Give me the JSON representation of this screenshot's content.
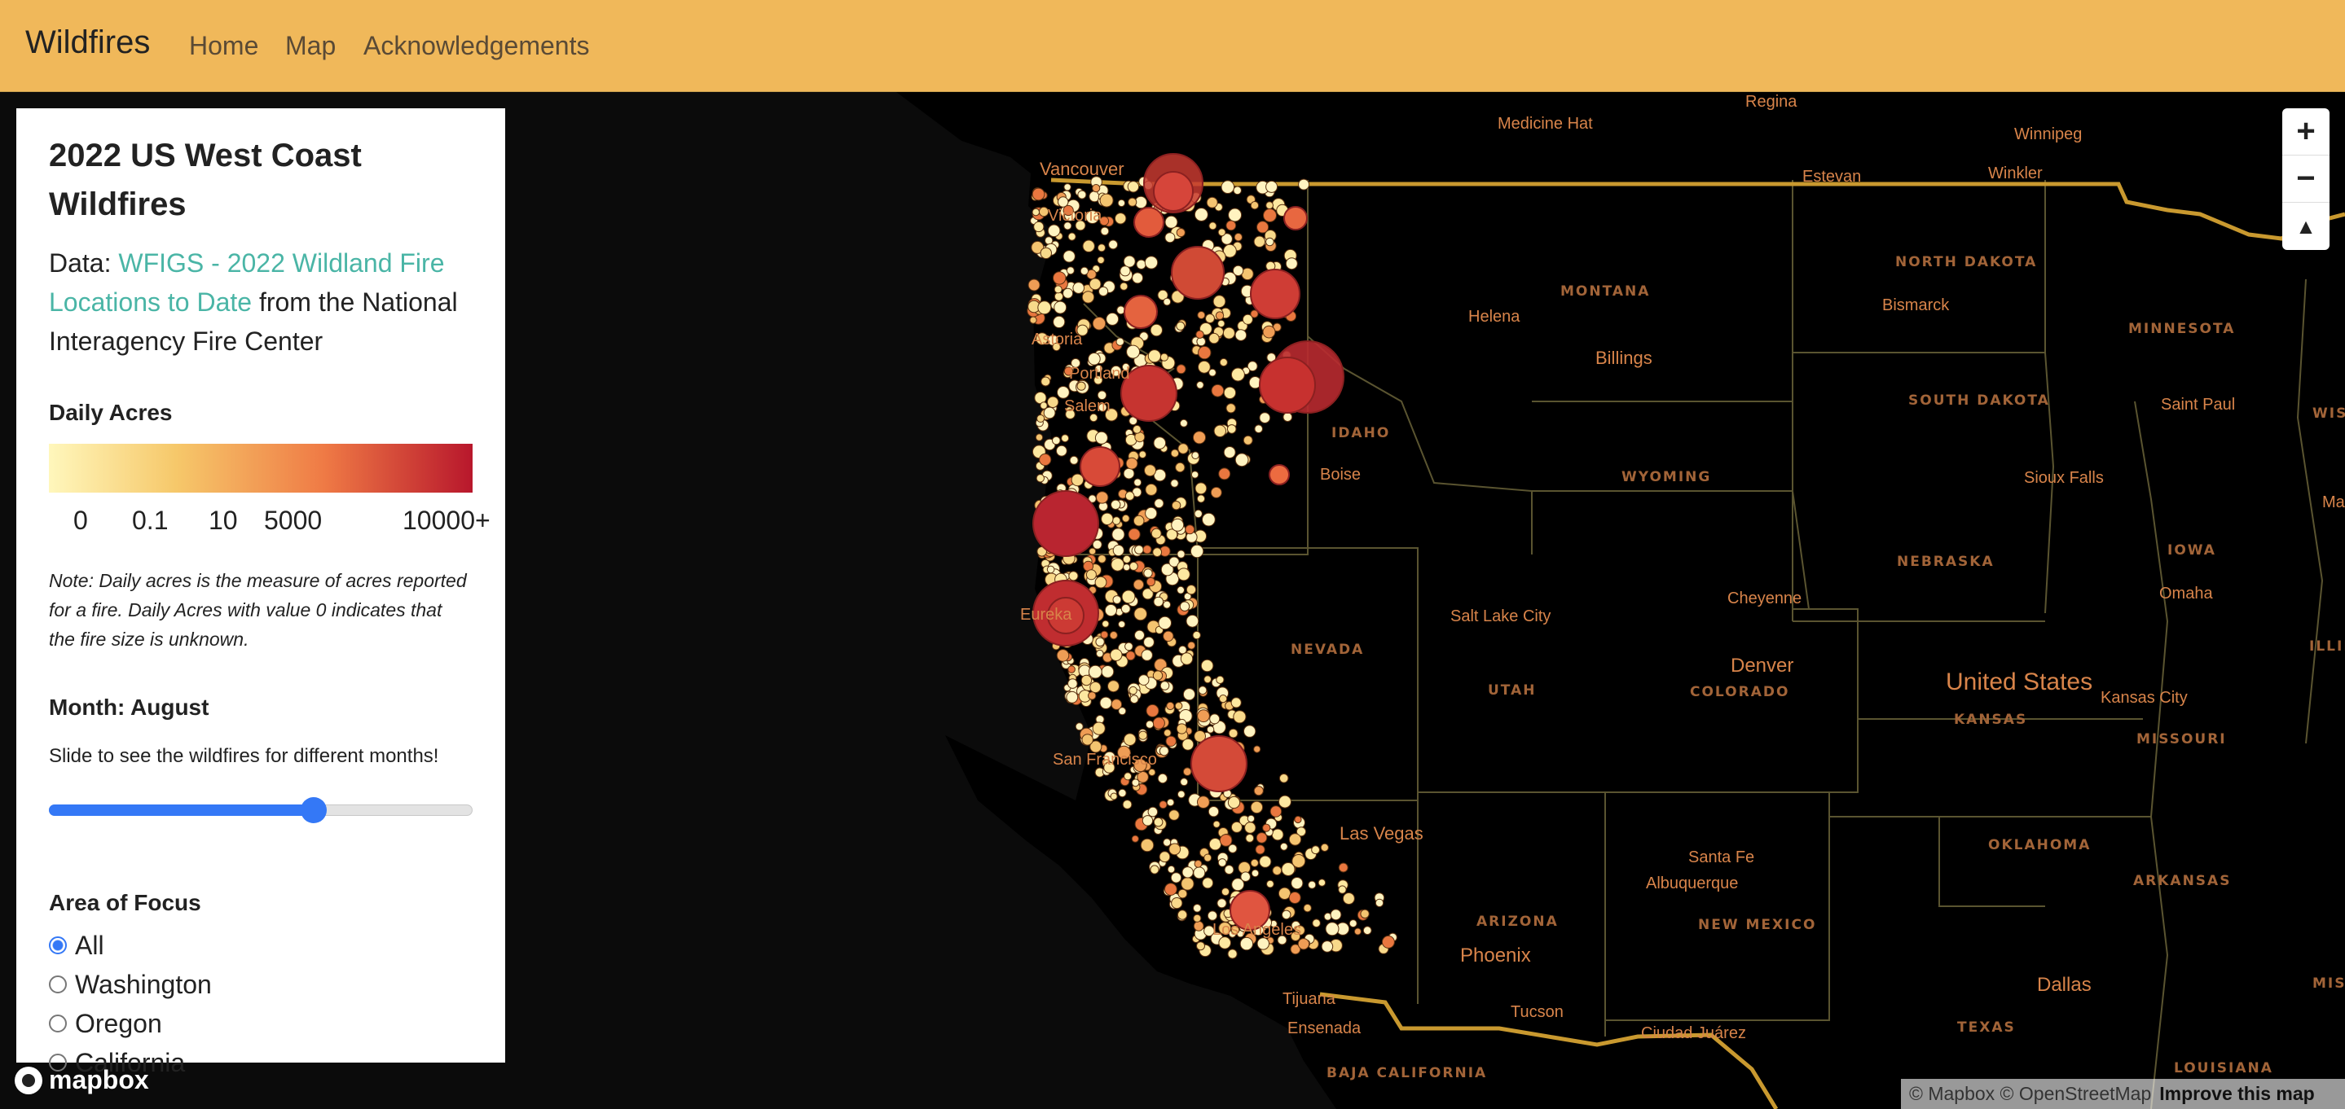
{
  "nav": {
    "brand": "Wildfires",
    "links": [
      "Home",
      "Map",
      "Acknowledgements"
    ]
  },
  "panel": {
    "title": "2022 US West Coast Wildfires",
    "data_prefix": "Data: ",
    "data_link": "WFIGS - 2022 Wildland Fire Locations to Date",
    "data_suffix": " from the National Interagency Fire Center",
    "legend_title": "Daily Acres",
    "legend_labels": [
      "0",
      "0.1",
      "10",
      "5000",
      "10000+"
    ],
    "legend_colors": [
      "#fff7bc",
      "#f6c86a",
      "#ef7a45",
      "#b8172c"
    ],
    "note": "Note: Daily acres is the measure of acres reported for a fire. Daily Acres with value 0 indicates that the fire size is unknown.",
    "month_label": "Month: August",
    "instructions": "Slide to see the wildfires for different months!",
    "slider_fraction": 0.625,
    "area_title": "Area of Focus",
    "areas": [
      "All",
      "Washington",
      "Oregon",
      "California"
    ],
    "selected_area": "All"
  },
  "map": {
    "cities": [
      "Medicine Hat",
      "Regina",
      "Winnipeg",
      "Vancouver",
      "Estevan",
      "Winkler",
      "Victoria",
      "Helena",
      "Bismarck",
      "Astoria",
      "Billings",
      "Portland",
      "Salem",
      "Saint Paul",
      "Sioux Falls",
      "Boise",
      "Omaha",
      "Salt Lake City",
      "Cheyenne",
      "Denver",
      "United States",
      "Kansas City",
      "San Francisco",
      "Las Vegas",
      "Santa Fe",
      "Albuquerque",
      "Phoenix",
      "Los Angeles",
      "Tijuana",
      "Tucson",
      "Ciudad Juárez",
      "Ensenada",
      "Dallas",
      "Madison",
      "Eureka"
    ],
    "states": [
      "MONTANA",
      "NORTH DAKOTA",
      "MINNESOTA",
      "SOUTH DAKOTA",
      "WISCONSIN",
      "IDAHO",
      "WYOMING",
      "NEBRASKA",
      "IOWA",
      "ILLINOIS",
      "NEVADA",
      "UTAH",
      "COLORADO",
      "KANSAS",
      "MISSOURI",
      "ARIZONA",
      "NEW MEXICO",
      "OKLAHOMA",
      "ARKANSAS",
      "TEXAS",
      "LOUISIANA",
      "MISSISSIPPI",
      "BAJA CALIFORNIA"
    ]
  },
  "attribution": {
    "text": "© Mapbox © OpenStreetMap",
    "improve": "Improve this map",
    "logo": "mapbox"
  },
  "colors": {
    "navbar": "#f0b85a",
    "link": "#4ab5a6",
    "accent": "#3478f6"
  }
}
